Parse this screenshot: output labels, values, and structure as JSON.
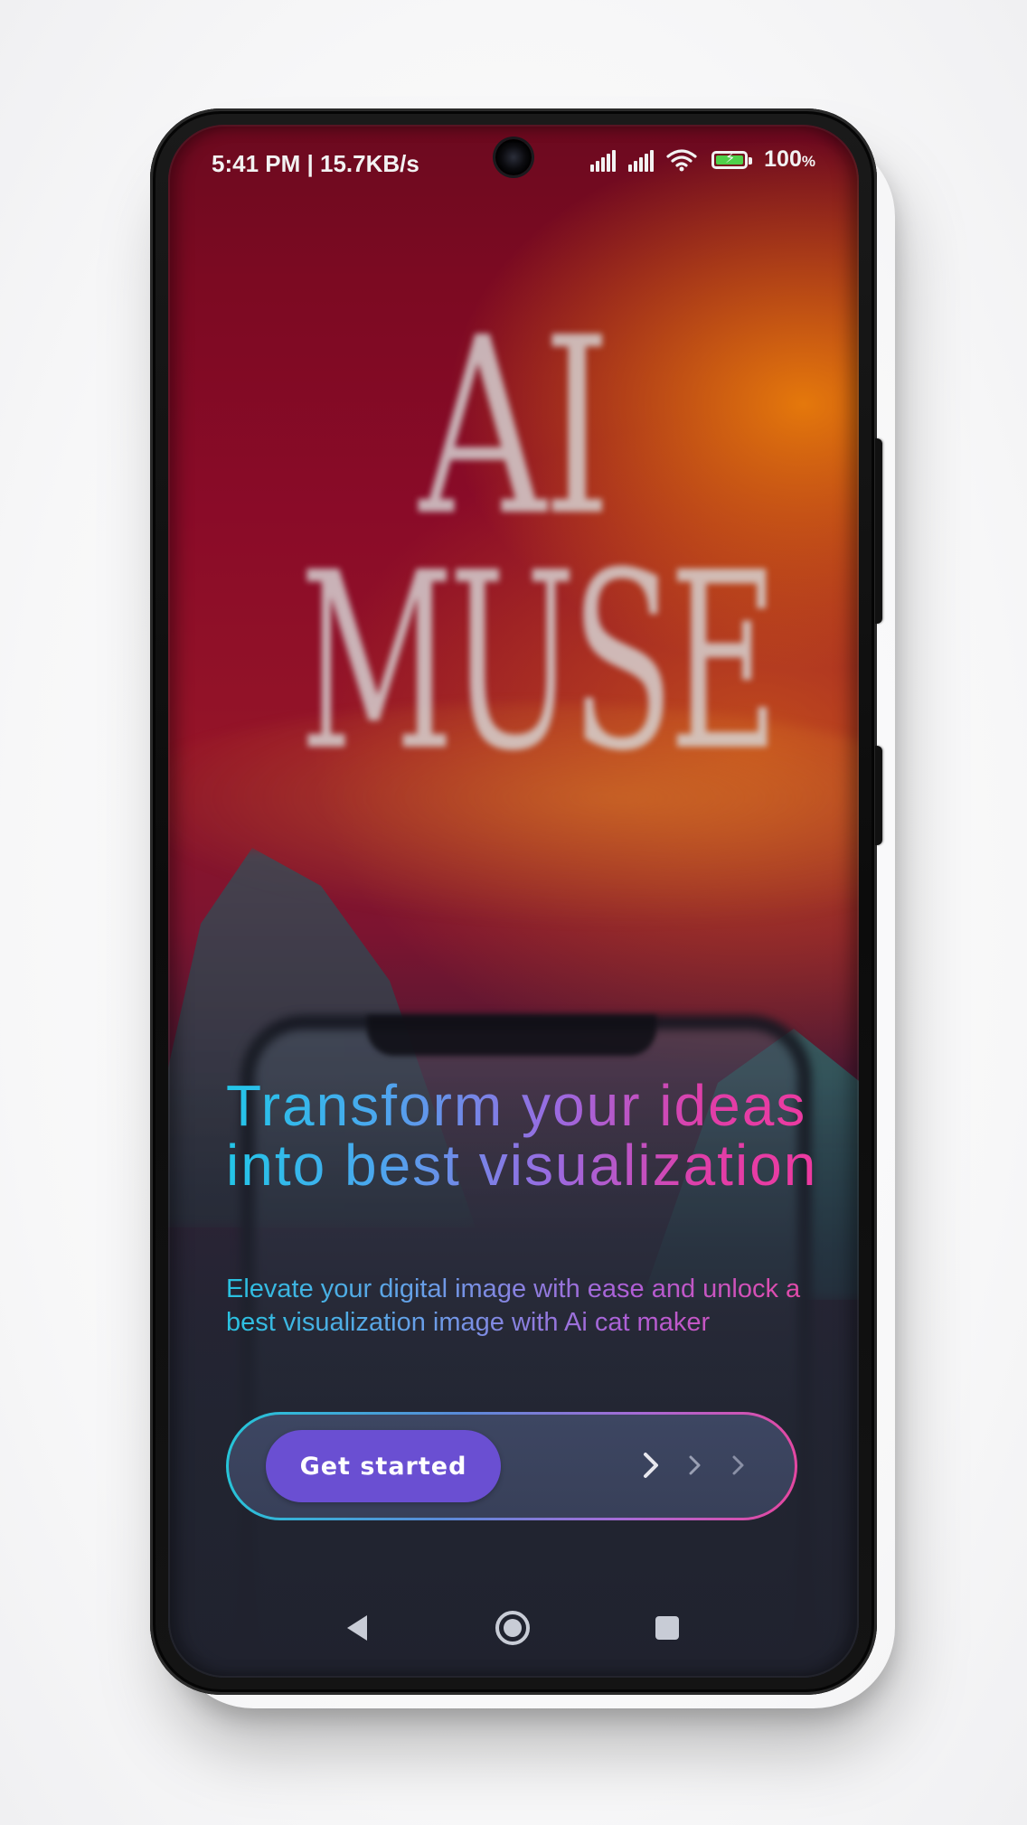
{
  "status_bar": {
    "time_speed": "5:41 PM | 15.7KB/s",
    "battery_percent": "100",
    "battery_percent_sign": "%",
    "battery_level": 1.0,
    "icons": [
      "signal-icon",
      "signal-icon",
      "wifi-icon",
      "battery-charging-icon"
    ]
  },
  "hero_art": {
    "line1": "AI",
    "line2": "MUSE"
  },
  "onboarding": {
    "headline": "Transform your ideas into best visualization",
    "subtitle": "Elevate your digital image with ease and unlock a best visualization image with Ai cat maker",
    "cta_label": "Get started",
    "chevron_icons": [
      "chevron-right-icon",
      "chevron-right-icon",
      "chevron-right-icon"
    ]
  },
  "nav_bar": {
    "items": [
      "back-icon",
      "home-icon",
      "recents-icon"
    ]
  },
  "colors": {
    "cta_button": "#6a4fd2",
    "text_gradient_start": "#22c6e8",
    "text_gradient_mid": "#9a6ae0",
    "text_gradient_end": "#ee3aa0",
    "battery_fill": "#4fd04a"
  }
}
